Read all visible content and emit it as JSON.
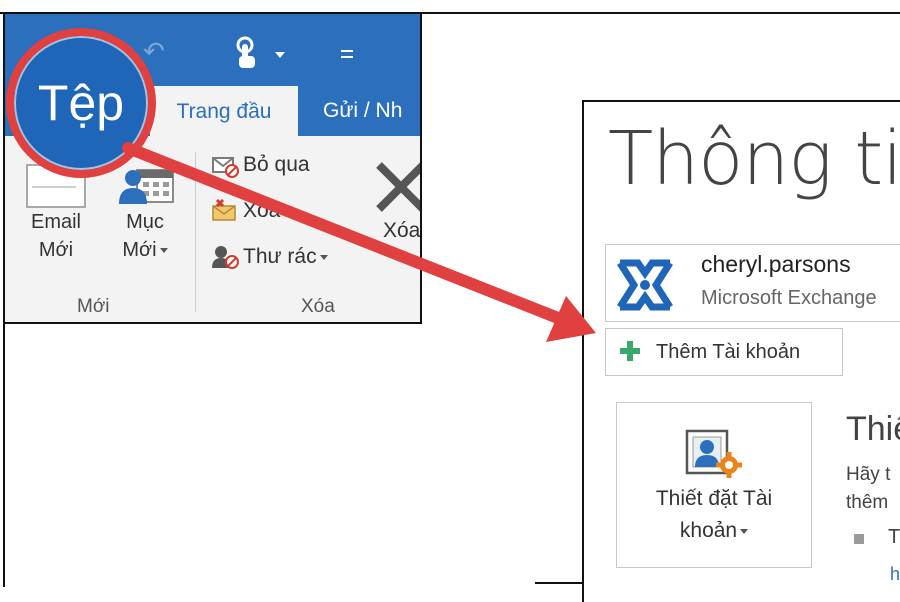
{
  "ribbon": {
    "file_tab": "Tệp",
    "tabs": [
      "Trang đầu",
      "Gửi / Nh"
    ],
    "new_group": {
      "label": "Mới",
      "email_btn": [
        "Email",
        "Mới"
      ],
      "items_btn": [
        "Mục",
        "Mới"
      ]
    },
    "delete_group": {
      "label": "Xóa",
      "ignore": "Bỏ qua",
      "cleanup": "Xóa",
      "junk": "Thư rác",
      "delete": "Xóa"
    }
  },
  "account_info": {
    "title": "Thông tin",
    "account_name": "cheryl.parsons",
    "account_type": "Microsoft Exchange",
    "add_account": "Thêm Tài khoản",
    "settings_btn": [
      "Thiết đặt Tài",
      "khoản"
    ],
    "side_heading": "Thiế",
    "side_text": [
      "Hãy t",
      "thêm"
    ],
    "bullet_text": "T",
    "link_tail": "h"
  },
  "colors": {
    "office_blue": "#2b6fbd",
    "highlight_red": "#e0403f",
    "add_green": "#3aa86b"
  }
}
